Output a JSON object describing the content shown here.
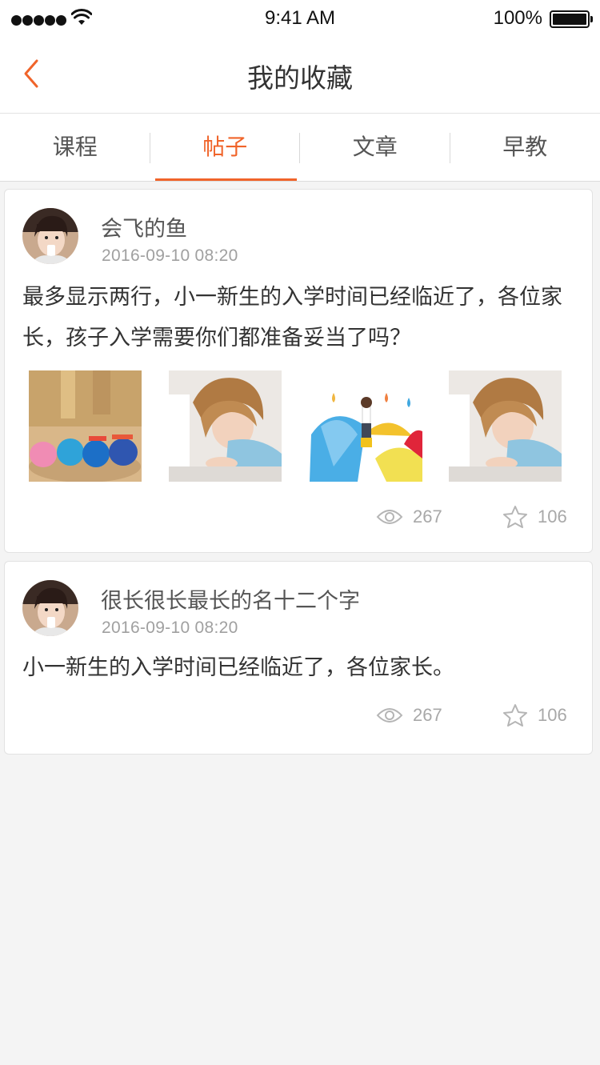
{
  "status_bar": {
    "time": "9:41 AM",
    "battery": "100%"
  },
  "nav": {
    "title": "我的收藏"
  },
  "tabs": [
    {
      "label": "课程"
    },
    {
      "label": "帖子"
    },
    {
      "label": "文章"
    },
    {
      "label": "早教"
    }
  ],
  "active_tab": "帖子",
  "posts": [
    {
      "author": "会飞的鱼",
      "timestamp": "2016-09-10  08:20",
      "text": "最多显示两行，小一新生的入学时间已经临近了，各位家长，孩子入学需要你们都准备妥当了吗？",
      "images": [
        "shoes-photo",
        "girl-laptop-photo",
        "umbrellas-photo",
        "girl-laptop-photo"
      ],
      "views": "267",
      "favorites": "106"
    },
    {
      "author": "很长很长最长的名十二个字",
      "timestamp": "2016-09-10  08:20",
      "text": "小一新生的入学时间已经临近了，各位家长。",
      "images": [],
      "views": "267",
      "favorites": "106"
    }
  ],
  "colors": {
    "accent": "#f0642a",
    "background": "#f4f4f4",
    "muted": "#a0a0a0"
  }
}
